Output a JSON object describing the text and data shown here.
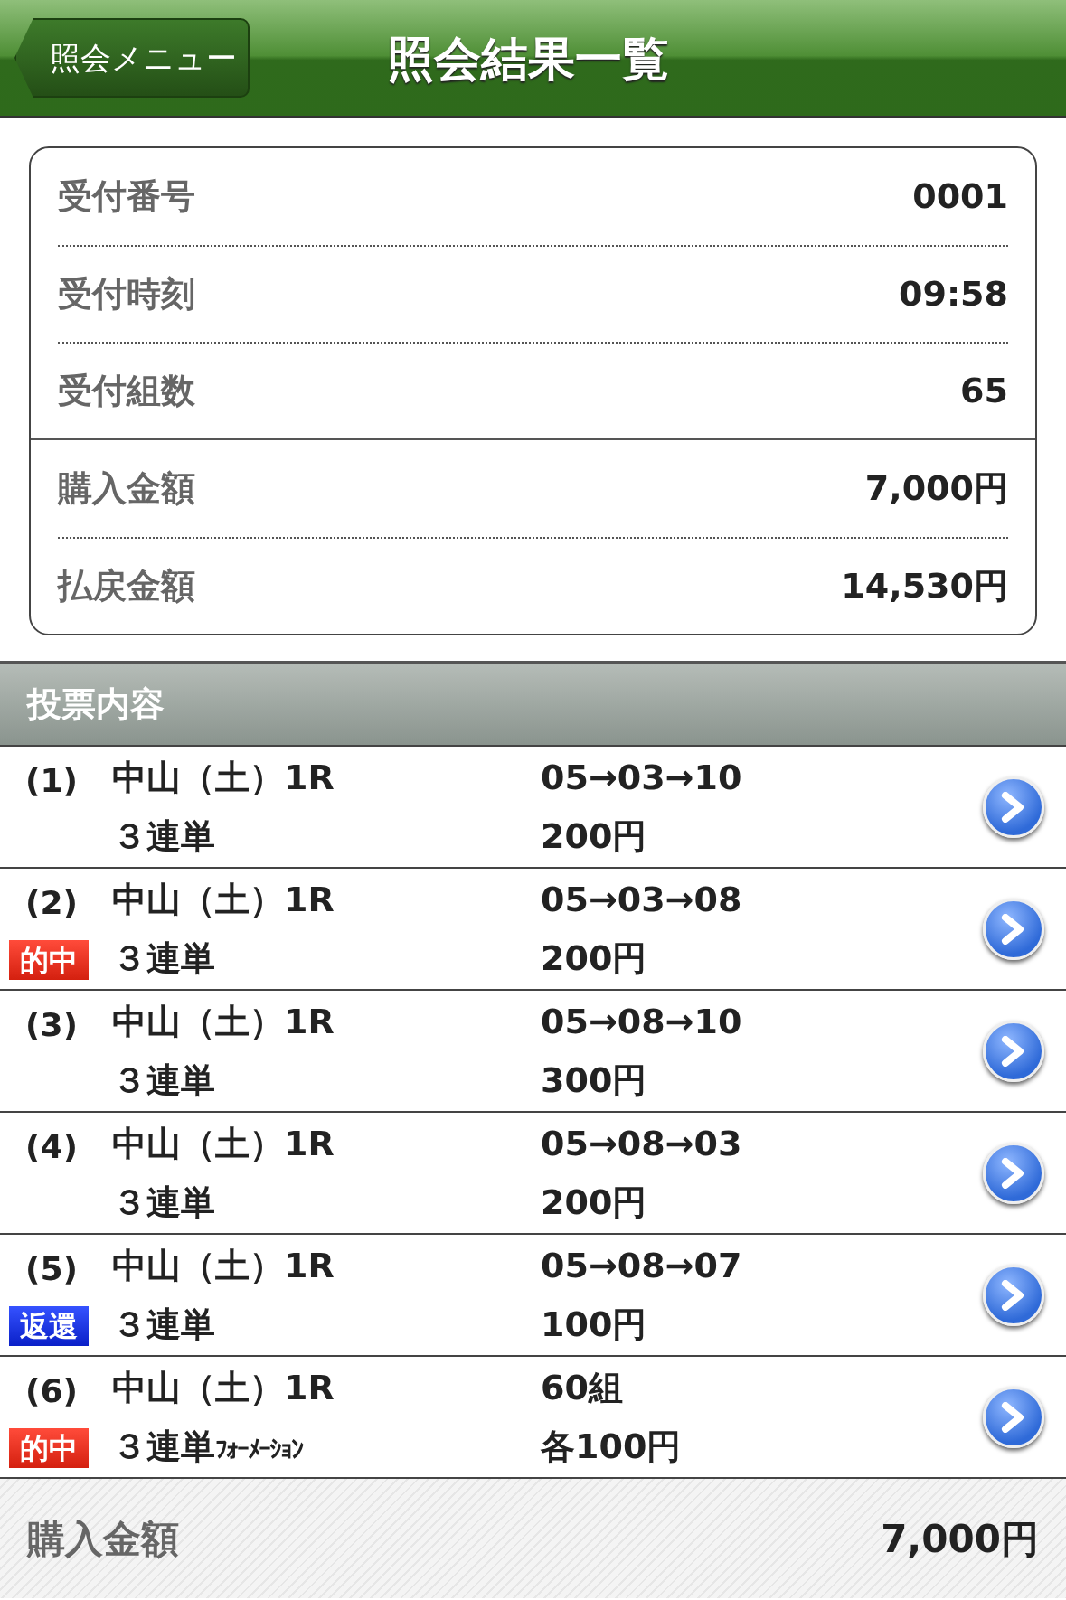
{
  "header": {
    "back_button": "照会メニュー",
    "title": "照会結果一覧"
  },
  "summary_groups": [
    [
      {
        "label": "受付番号",
        "value": "0001"
      },
      {
        "label": "受付時刻",
        "value": "09:58"
      },
      {
        "label": "受付組数",
        "value": "65"
      }
    ],
    [
      {
        "label": "購入金額",
        "value": "7,000円"
      },
      {
        "label": "払戻金額",
        "value": "14,530円"
      }
    ]
  ],
  "section_title": "投票内容",
  "bets": [
    {
      "number": "(1)",
      "race": "中山（土）1R",
      "bet_type": "３連単",
      "combination": "05→03→10",
      "amount": "200円"
    },
    {
      "number": "(2)",
      "badge": {
        "kind": "hit",
        "label": "的中"
      },
      "race": "中山（土）1R",
      "bet_type": "３連単",
      "combination": "05→03→08",
      "amount": "200円"
    },
    {
      "number": "(3)",
      "race": "中山（土）1R",
      "bet_type": "３連単",
      "combination": "05→08→10",
      "amount": "300円"
    },
    {
      "number": "(4)",
      "race": "中山（土）1R",
      "bet_type": "３連単",
      "combination": "05→08→03",
      "amount": "200円"
    },
    {
      "number": "(5)",
      "badge": {
        "kind": "refund",
        "label": "返還"
      },
      "race": "中山（土）1R",
      "bet_type": "３連単",
      "combination": "05→08→07",
      "amount": "100円"
    },
    {
      "number": "(6)",
      "badge": {
        "kind": "hit",
        "label": "的中"
      },
      "race": "中山（土）1R",
      "bet_type": "３連単",
      "bet_type_suffix": "ﾌｫｰﾒｰｼｮﾝ",
      "combination": "60組",
      "amount": "各100円"
    }
  ],
  "footer": {
    "label": "購入金額",
    "value": "7,000円"
  }
}
